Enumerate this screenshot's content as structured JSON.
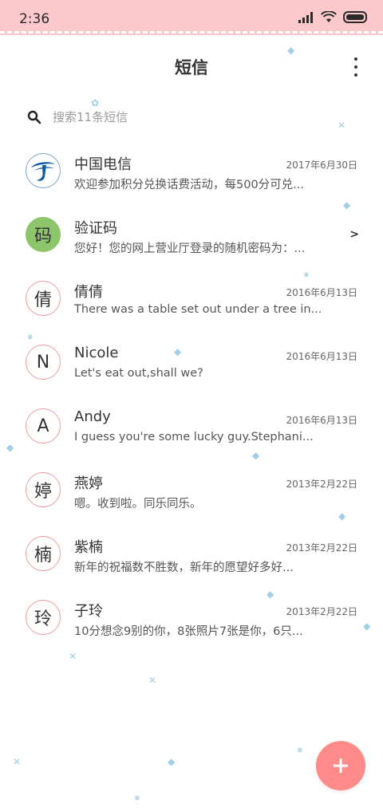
{
  "status_bar": {
    "time": "2:36"
  },
  "header": {
    "title": "短信"
  },
  "search": {
    "placeholder": "搜索11条短信"
  },
  "conversations": [
    {
      "name": "中国电信",
      "date": "2017年6月30日",
      "preview": "欢迎参加积分兑换话费活动，每500分可兑...",
      "avatar_type": "logo"
    },
    {
      "name": "验证码",
      "date": "",
      "preview": "您好！您的网上营业厅登录的随机密码为：...",
      "avatar_char": "码",
      "avatar_type": "green"
    },
    {
      "name": "倩倩",
      "date": "2016年6月13日",
      "preview": "There was a table set out under a tree in...",
      "avatar_char": "倩"
    },
    {
      "name": "Nicole",
      "date": "2016年6月13日",
      "preview": "Let's eat out,shall we?",
      "avatar_char": "N"
    },
    {
      "name": "Andy",
      "date": "2016年6月13日",
      "preview": "I guess you're some lucky guy.Stephani...",
      "avatar_char": "A"
    },
    {
      "name": "燕婷",
      "date": "2013年2月22日",
      "preview": "嗯。收到啦。同乐同乐。",
      "avatar_char": "婷"
    },
    {
      "name": "紫楠",
      "date": "2013年2月22日",
      "preview": "新年的祝福数不胜数，新年的愿望好多好...",
      "avatar_char": "楠"
    },
    {
      "name": "子玲",
      "date": "2013年2月22日",
      "preview": "10分想念9别的你，8张照片7张是你，6只...",
      "avatar_char": "玲"
    }
  ],
  "colors": {
    "status_bar": "#fbc8cc",
    "avatar_ring": "#f29a9c",
    "fab": "#ff8a8a",
    "avatar_green": "#8cc56a",
    "confetti": "#9fd0e8"
  },
  "icons": {
    "search": "search-icon",
    "menu": "more-vert-icon",
    "fab": "plus-icon",
    "chevron": "chevron-right-icon"
  }
}
